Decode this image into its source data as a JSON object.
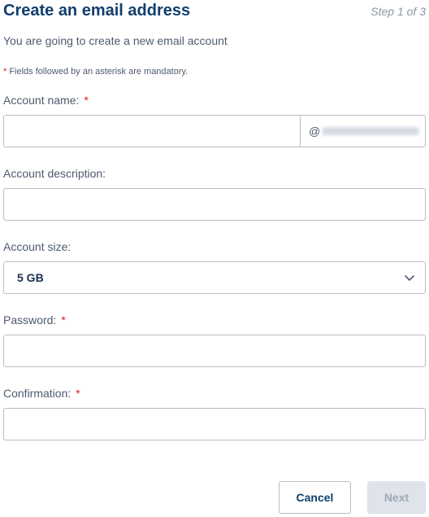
{
  "header": {
    "title": "Create an email address",
    "step": "Step 1 of 3"
  },
  "intro": "You are going to create a new email account",
  "mandatory_note": {
    "asterisk": "*",
    "text": " Fields followed by an asterisk are mandatory."
  },
  "fields": {
    "account_name": {
      "label": "Account name:",
      "required": "*",
      "value": "",
      "placeholder": "",
      "domain_prefix": "@"
    },
    "account_description": {
      "label": "Account description:",
      "value": "",
      "placeholder": ""
    },
    "account_size": {
      "label": "Account size:",
      "selected": "5 GB"
    },
    "password": {
      "label": "Password:",
      "required": "*",
      "value": "",
      "placeholder": ""
    },
    "confirmation": {
      "label": "Confirmation:",
      "required": "*",
      "value": "",
      "placeholder": ""
    }
  },
  "buttons": {
    "cancel": "Cancel",
    "next": "Next"
  },
  "icons": {
    "select_chevron": "chevron-down-icon"
  },
  "colors": {
    "title": "#113f6d",
    "asterisk": "#e1191f",
    "border": "#b7bcc6",
    "disabled_bg": "#dfe3ea"
  }
}
